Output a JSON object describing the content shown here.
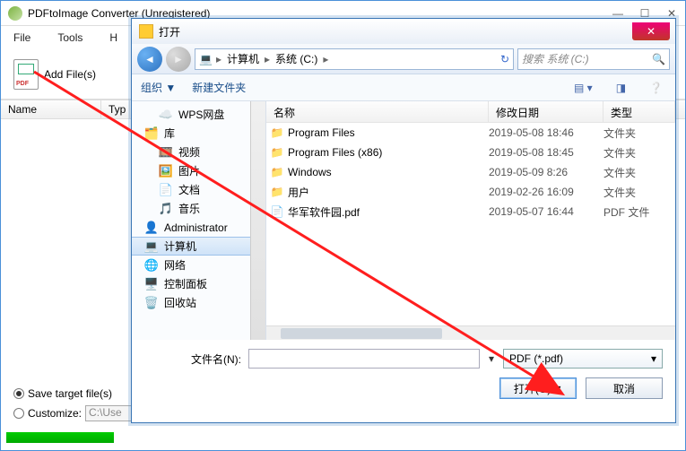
{
  "main": {
    "title": "PDFtoImage Converter (Unregistered)",
    "menu": [
      "File",
      "Tools",
      "H"
    ],
    "add_files": "Add File(s)",
    "columns": {
      "name": "Name",
      "type": "Typ"
    },
    "radio_save": "Save target file(s)",
    "radio_custom": "Customize:",
    "custom_path": "C:\\Use"
  },
  "dialog": {
    "title": "打开",
    "path": {
      "segments": [
        "计算机",
        "系统 (C:)"
      ],
      "drive_icn": "💻"
    },
    "search_placeholder": "搜索 系统 (C:)",
    "toolbar": {
      "organize": "组织",
      "sep": "▼",
      "newfolder": "新建文件夹"
    },
    "tree": [
      {
        "icn": "☁️",
        "label": "WPS网盘",
        "ind": true,
        "c": "#3a9"
      },
      {
        "icn": "🗂️",
        "label": "库",
        "ind": false,
        "c": "#59c"
      },
      {
        "icn": "🎞️",
        "label": "视频",
        "ind": true,
        "c": "#36d"
      },
      {
        "icn": "🖼️",
        "label": "图片",
        "ind": true,
        "c": "#3ac"
      },
      {
        "icn": "📄",
        "label": "文档",
        "ind": true,
        "c": "#888"
      },
      {
        "icn": "🎵",
        "label": "音乐",
        "ind": true,
        "c": "#fb3"
      },
      {
        "icn": "👤",
        "label": "Administrator",
        "ind": false,
        "c": "#3a9"
      },
      {
        "icn": "💻",
        "label": "计算机",
        "ind": false,
        "sel": true,
        "c": "#59c"
      },
      {
        "icn": "🌐",
        "label": "网络",
        "ind": false,
        "c": "#3ad"
      },
      {
        "icn": "🖥️",
        "label": "控制面板",
        "ind": false,
        "c": "#3ad"
      },
      {
        "icn": "🗑️",
        "label": "回收站",
        "ind": false,
        "c": "#888"
      }
    ],
    "list_head": {
      "name": "名称",
      "date": "修改日期",
      "type": "类型"
    },
    "rows": [
      {
        "kind": "folder",
        "name": "Program Files",
        "date": "2019-05-08 18:46",
        "type": "文件夹"
      },
      {
        "kind": "folder",
        "name": "Program Files (x86)",
        "date": "2019-05-08 18:45",
        "type": "文件夹"
      },
      {
        "kind": "folder",
        "name": "Windows",
        "date": "2019-05-09 8:26",
        "type": "文件夹"
      },
      {
        "kind": "folder",
        "name": "用户",
        "date": "2019-02-26 16:09",
        "type": "文件夹"
      },
      {
        "kind": "file",
        "name": "华军软件园.pdf",
        "date": "2019-05-07 16:44",
        "type": "PDF 文件"
      }
    ],
    "filename_label": "文件名(N):",
    "filter": "PDF (*.pdf)",
    "open_btn": "打开(O)",
    "cancel_btn": "取消"
  }
}
